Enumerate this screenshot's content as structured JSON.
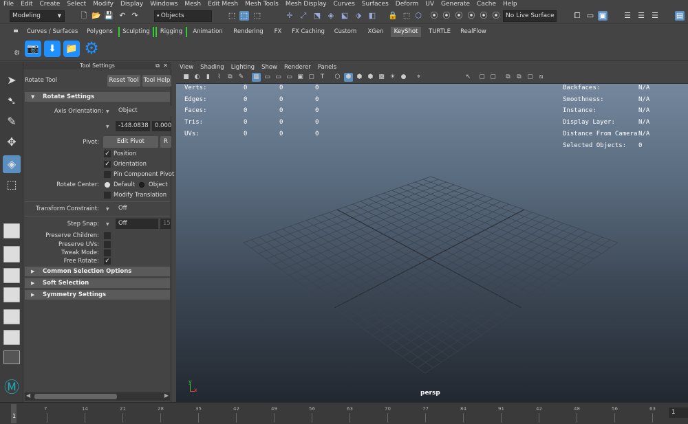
{
  "menubar": [
    "File",
    "Edit",
    "Create",
    "Select",
    "Modify",
    "Display",
    "Windows",
    "Mesh",
    "Edit Mesh",
    "Mesh Tools",
    "Mesh Display",
    "Curves",
    "Surfaces",
    "Deform",
    "UV",
    "Generate",
    "Cache",
    "Help"
  ],
  "statusline": {
    "workspace": "Modeling",
    "selection_mode": "Objects",
    "live_surface": "No Live Surface"
  },
  "shelf_tabs": [
    "Curves / Surfaces",
    "Polygons",
    "Sculpting",
    "Rigging",
    "Animation",
    "Rendering",
    "FX",
    "FX Caching",
    "Custom",
    "XGen",
    "KeyShot",
    "TURTLE",
    "RealFlow"
  ],
  "shelf_active": "KeyShot",
  "tool_settings": {
    "panel_title": "Tool Settings",
    "tool_name": "Rotate Tool",
    "reset_tool": "Reset Tool",
    "tool_help": "Tool Help",
    "rotate_settings": "Rotate Settings",
    "axis_orientation_label": "Axis Orientation:",
    "axis_orientation_value": "Object",
    "axis_x": "-148.0838",
    "axis_y": "0.0000",
    "pivot_label": "Pivot:",
    "edit_pivot": "Edit Pivot",
    "reset_abbrev": "R",
    "position": "Position",
    "orientation": "Orientation",
    "pin_component_pivot": "Pin Component Pivot",
    "rotate_center_label": "Rotate Center:",
    "rc_default": "Default",
    "rc_object": "Object",
    "modify_translation": "Modify Translation",
    "transform_constraint_label": "Transform Constraint:",
    "transform_constraint_value": "Off",
    "step_snap_label": "Step Snap:",
    "step_snap_value": "Off",
    "step_snap_amount": "15",
    "preserve_children": "Preserve Children:",
    "preserve_uvs": "Preserve UVs:",
    "tweak_mode": "Tweak Mode:",
    "free_rotate": "Free Rotate:",
    "common_selection_options": "Common Selection Options",
    "soft_selection": "Soft Selection",
    "symmetry_settings": "Symmetry Settings"
  },
  "viewport": {
    "menu": [
      "View",
      "Shading",
      "Lighting",
      "Show",
      "Renderer",
      "Panels"
    ],
    "camera": "persp",
    "hud_left": [
      {
        "label": "Verts:",
        "v": [
          "0",
          "0",
          "0"
        ]
      },
      {
        "label": "Edges:",
        "v": [
          "0",
          "0",
          "0"
        ]
      },
      {
        "label": "Faces:",
        "v": [
          "0",
          "0",
          "0"
        ]
      },
      {
        "label": "Tris:",
        "v": [
          "0",
          "0",
          "0"
        ]
      },
      {
        "label": "UVs:",
        "v": [
          "0",
          "0",
          "0"
        ]
      }
    ],
    "hud_right": [
      {
        "label": "Backfaces:",
        "v": "N/A"
      },
      {
        "label": "Smoothness:",
        "v": "N/A"
      },
      {
        "label": "Instance:",
        "v": "N/A"
      },
      {
        "label": "Display Layer:",
        "v": "N/A"
      },
      {
        "label": "Distance From Camera:",
        "v": "N/A"
      },
      {
        "label": "Selected Objects:",
        "v": "0"
      }
    ],
    "axis_x": "x",
    "axis_y": "y"
  },
  "timeline": {
    "ticks": [
      "7",
      "14",
      "21",
      "28",
      "35",
      "42",
      "49",
      "56",
      "63",
      "70",
      "77",
      "84",
      "91",
      "42",
      "48",
      "56",
      "63"
    ],
    "current_frame": "1",
    "frame_field": "1"
  },
  "accent_colors": {
    "selection": "#5a8fbf",
    "shelf_icons": "#1e90ff",
    "workspace_marker": "#33cc33"
  }
}
